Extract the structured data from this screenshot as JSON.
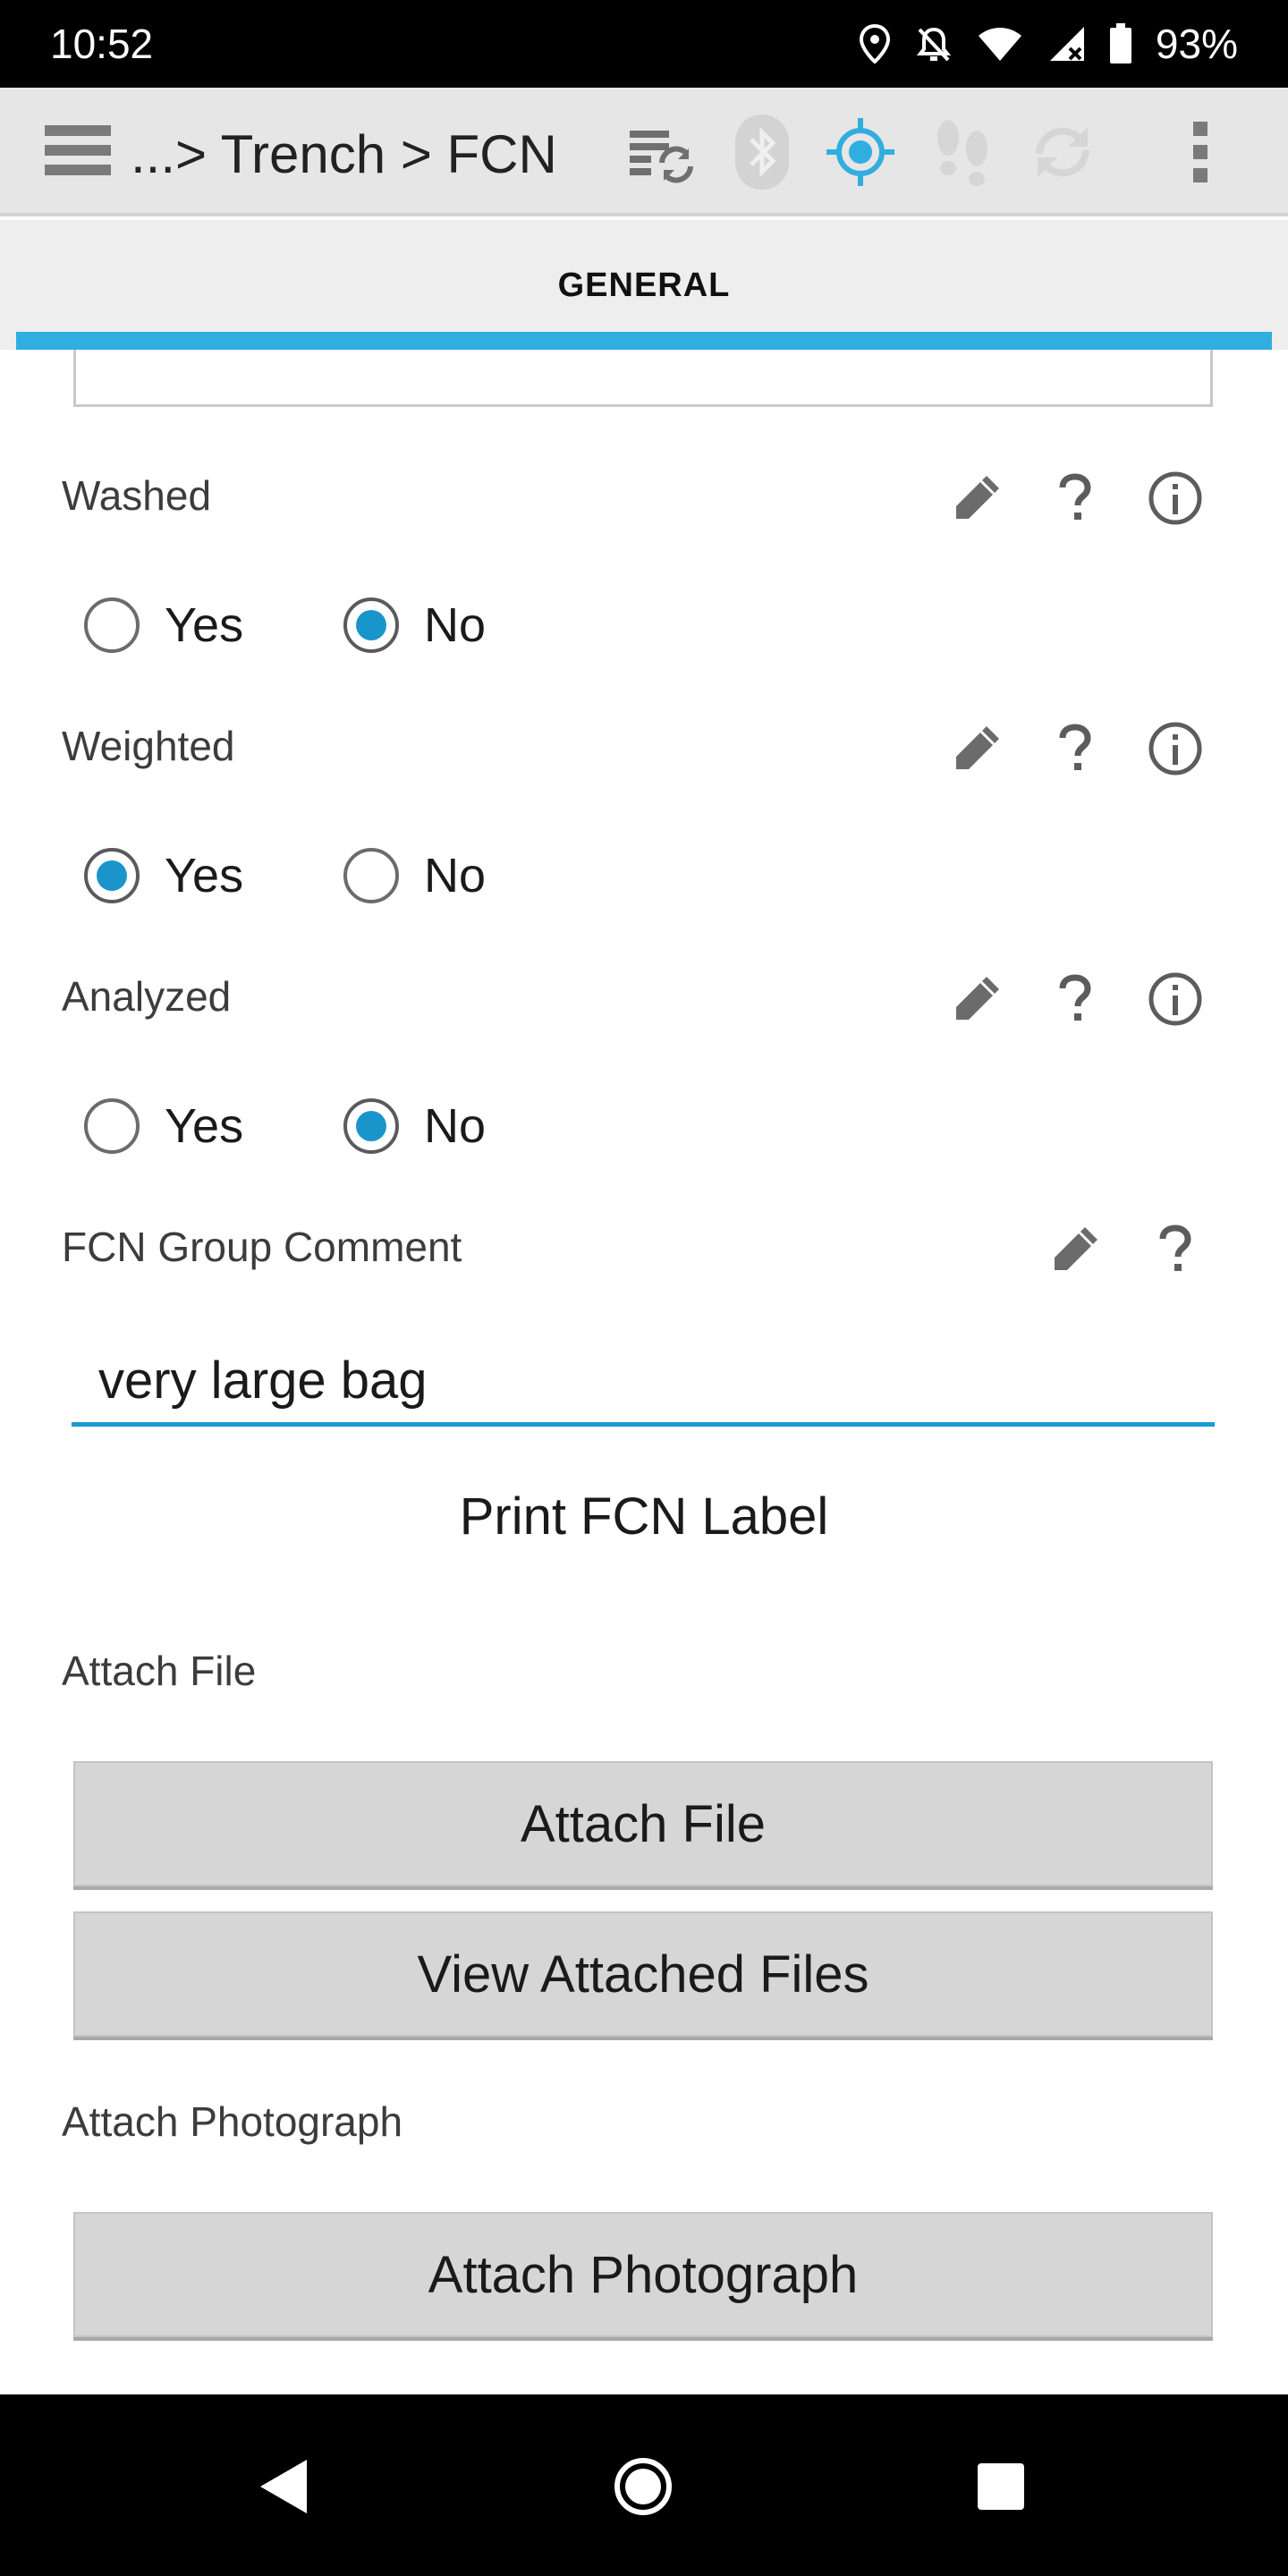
{
  "status_bar": {
    "time": "10:52",
    "battery_percent": "93%",
    "icons": [
      "location-icon",
      "alarm-off-icon",
      "wifi-icon",
      "cell-signal-icon",
      "battery-icon"
    ]
  },
  "toolbar": {
    "title": "...> Trench > FCN",
    "icons": [
      "menu-icon",
      "sync-list-icon",
      "bluetooth-icon",
      "gps-target-icon",
      "footsteps-icon",
      "refresh-icon",
      "more-vert-icon"
    ]
  },
  "tabs": [
    {
      "label": "GENERAL",
      "selected": true
    }
  ],
  "colors": {
    "accent": "#31aee0",
    "radio_selected": "#1a95cc",
    "toolbar_bg": "#e6e6e6",
    "button_bg": "#d6d6d6"
  },
  "form": {
    "washed": {
      "label": "Washed",
      "options": [
        "Yes",
        "No"
      ],
      "selected": "No"
    },
    "weighted": {
      "label": "Weighted",
      "options": [
        "Yes",
        "No"
      ],
      "selected": "Yes"
    },
    "analyzed": {
      "label": "Analyzed",
      "options": [
        "Yes",
        "No"
      ],
      "selected": "No"
    },
    "comment": {
      "label": "FCN Group Comment",
      "value": "very large bag"
    },
    "print_label": "Print FCN Label",
    "attach_file": {
      "label": "Attach File",
      "button": "Attach File",
      "view_button": "View Attached Files"
    },
    "attach_photo": {
      "label": "Attach Photograph",
      "button": "Attach Photograph"
    }
  }
}
